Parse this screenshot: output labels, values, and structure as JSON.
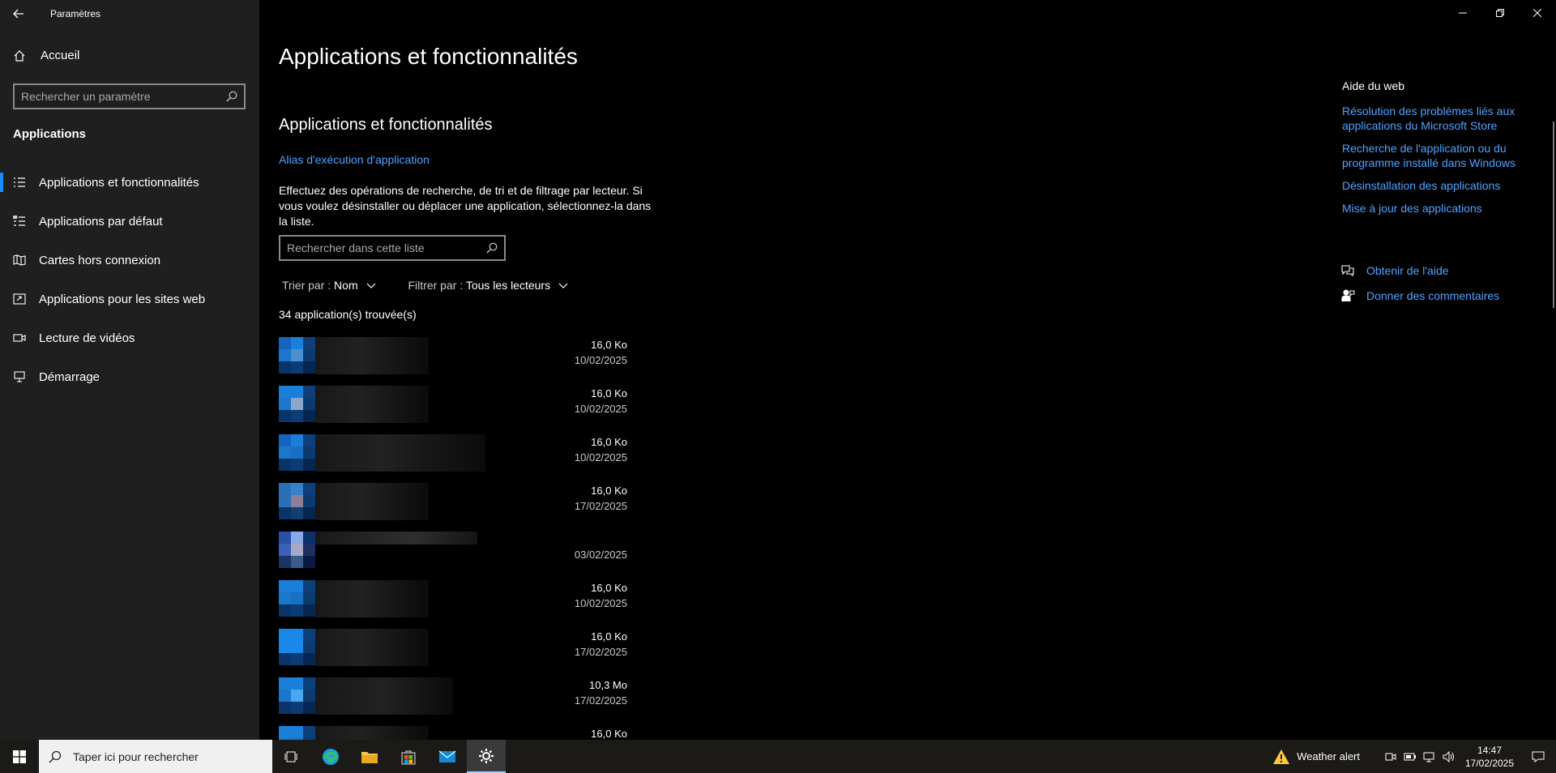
{
  "window": {
    "title": "Paramètres"
  },
  "sidebar": {
    "home_label": "Accueil",
    "search_placeholder": "Rechercher un paramètre",
    "section_label": "Applications",
    "items": [
      {
        "label": "Applications et fonctionnalités",
        "icon": "apps-list-icon",
        "active": true
      },
      {
        "label": "Applications par défaut",
        "icon": "default-apps-icon",
        "active": false
      },
      {
        "label": "Cartes hors connexion",
        "icon": "map-icon",
        "active": false
      },
      {
        "label": "Applications pour les sites web",
        "icon": "web-apps-icon",
        "active": false
      },
      {
        "label": "Lecture de vidéos",
        "icon": "video-icon",
        "active": false
      },
      {
        "label": "Démarrage",
        "icon": "startup-icon",
        "active": false
      }
    ]
  },
  "main": {
    "page_title": "Applications et fonctionnalités",
    "section_title": "Applications et fonctionnalités",
    "alias_link": "Alias d'exécution d'application",
    "description": "Effectuez des opérations de recherche, de tri et de filtrage par lecteur. Si vous voulez désinstaller ou déplacer une application, sélectionnez-la dans la liste.",
    "list_search_placeholder": "Rechercher dans cette liste",
    "sort_label": "Trier par :",
    "sort_value": "Nom",
    "filter_label": "Filtrer par :",
    "filter_value": "Tous les lecteurs",
    "count_text": "34 application(s) trouvée(s)",
    "apps": [
      {
        "size": "16,0 Ko",
        "date": "10/02/2025"
      },
      {
        "size": "16,0 Ko",
        "date": "10/02/2025"
      },
      {
        "size": "16,0 Ko",
        "date": "10/02/2025"
      },
      {
        "size": "16,0 Ko",
        "date": "17/02/2025"
      },
      {
        "size": "",
        "date": "03/02/2025"
      },
      {
        "size": "16,0 Ko",
        "date": "10/02/2025"
      },
      {
        "size": "16,0 Ko",
        "date": "17/02/2025"
      },
      {
        "size": "10,3 Mo",
        "date": "17/02/2025"
      },
      {
        "size": "16,0 Ko",
        "date": ""
      }
    ]
  },
  "help": {
    "title": "Aide du web",
    "links": [
      "Résolution des problèmes liés aux applications du Microsoft Store",
      "Recherche de l'application ou du programme installé dans Windows",
      "Désinstallation des applications",
      "Mise à jour des applications"
    ],
    "get_help": "Obtenir de l'aide",
    "feedback": "Donner des commentaires"
  },
  "taskbar": {
    "search_placeholder": "Taper ici pour rechercher",
    "weather_text": "Weather alert",
    "time": "14:47",
    "date": "17/02/2025",
    "pinned": [
      "task-view-icon",
      "edge-icon",
      "file-explorer-icon",
      "store-icon",
      "mail-icon",
      "settings-icon"
    ]
  },
  "colors": {
    "accent": "#4ca3ff",
    "sidebar_bg": "#1f1f1f",
    "main_bg": "#000000",
    "active_indicator": "#1a8cff"
  }
}
